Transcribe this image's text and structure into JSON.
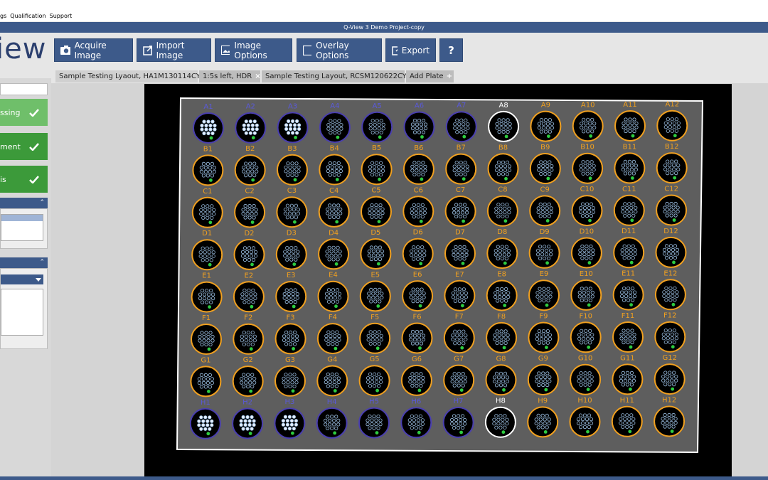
{
  "menu": {
    "items": [
      "gs",
      "Qualification",
      "Support"
    ]
  },
  "window": {
    "title": "Q-View 3 Demo Project-copy"
  },
  "logo": {
    "text": "iew"
  },
  "toolbar": {
    "acquire": "Acquire Image",
    "import": "Import Image",
    "image_options": "Image Options",
    "overlay_options": "Overlay Options",
    "export": "Export",
    "help": "?"
  },
  "steps": [
    {
      "label": "ssing",
      "color": "#6fbf6a"
    },
    {
      "label": "ment",
      "color": "#3c9a3a"
    },
    {
      "label": "is",
      "color": "#3c9a3a"
    }
  ],
  "plate_tabs": [
    {
      "label": "Sample Testing Lyaout, HA1M130114CY",
      "close": "×"
    },
    {
      "label": "1:5s left, HDR",
      "close": "×"
    },
    {
      "label": "Sample Testing Layout, RCSM120622CY",
      "close": "×"
    },
    {
      "label": "Add Plate",
      "close": "+"
    }
  ],
  "plate": {
    "rows": [
      "A",
      "B",
      "C",
      "D",
      "E",
      "F",
      "G",
      "H"
    ],
    "columns": [
      "1",
      "2",
      "3",
      "4",
      "5",
      "6",
      "7",
      "8",
      "9",
      "10",
      "11",
      "12"
    ],
    "selected_column": "8",
    "colors": {
      "blue_label": "#5a5ad8",
      "orange_label": "#f0a020",
      "white_label": "#ffffff",
      "plate_fill": "#5e5e5e",
      "spot": "#d0e0ff",
      "green_spot": "#2ecc40"
    }
  }
}
